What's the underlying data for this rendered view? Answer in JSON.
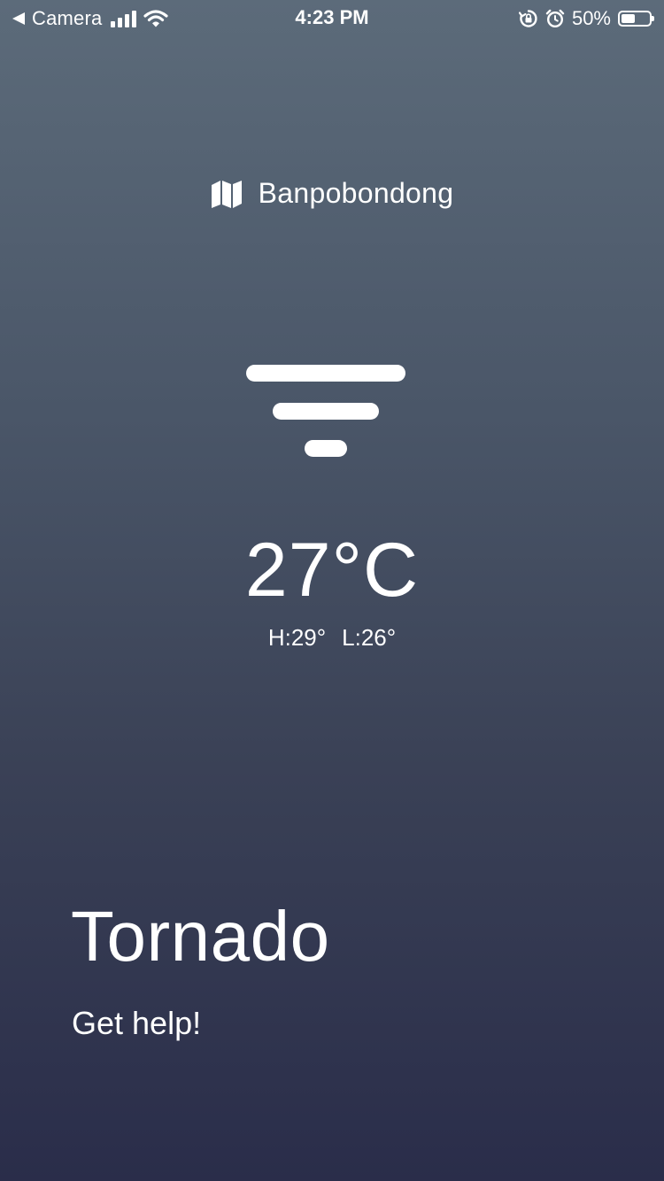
{
  "status_bar": {
    "back_label": "Camera",
    "time": "4:23 PM",
    "battery_percent_label": "50%",
    "battery_level": 0.5,
    "icons": [
      "back-caret-icon",
      "signal-bars-icon",
      "wifi-icon",
      "orientation-lock-icon",
      "alarm-icon",
      "battery-icon"
    ]
  },
  "location": {
    "icon": "map-icon",
    "name": "Banpobondong"
  },
  "weather": {
    "condition_icon": "tornado-icon",
    "temperature": "27°C",
    "high": "H:29°",
    "low": "L:26°"
  },
  "alert": {
    "title": "Tornado",
    "subtitle": "Get help!"
  },
  "colors": {
    "gradient_top": "#5c6b7a",
    "gradient_bottom": "#2a2d4a",
    "text": "#ffffff"
  }
}
